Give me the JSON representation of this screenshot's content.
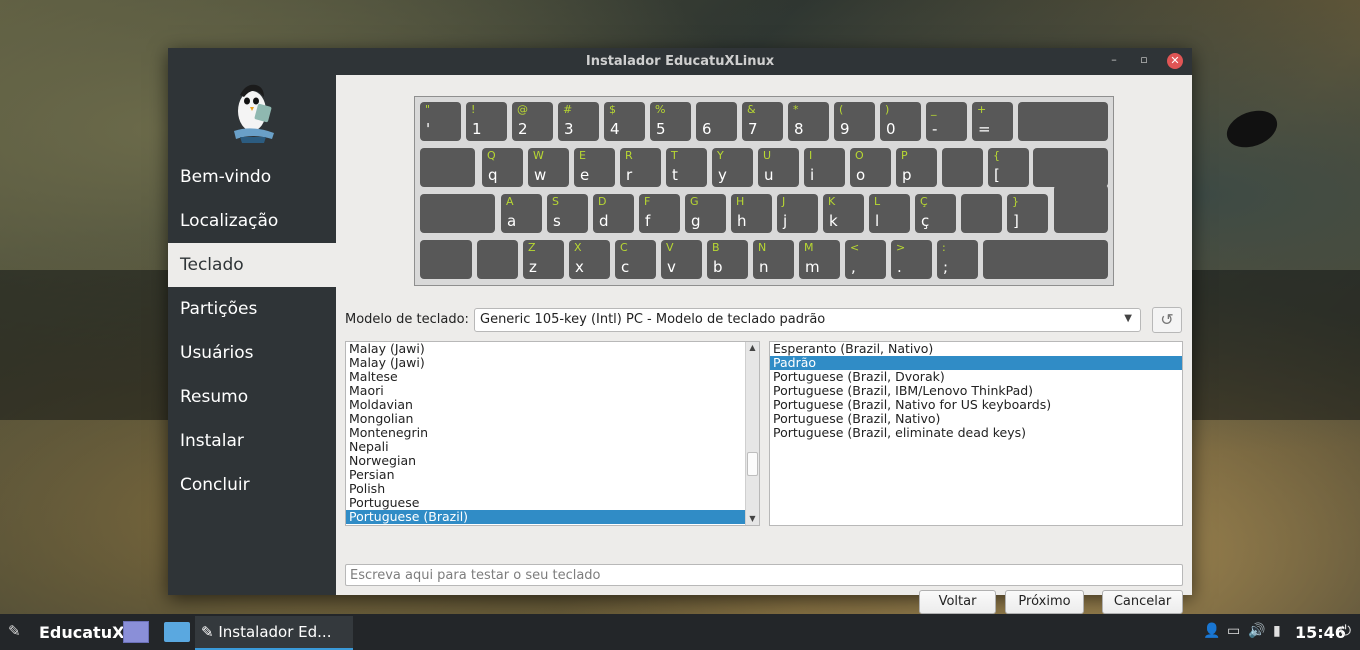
{
  "window": {
    "title": "Instalador EducatuXLinux"
  },
  "sidebar": {
    "items": [
      {
        "label": "Bem-vindo"
      },
      {
        "label": "Localização"
      },
      {
        "label": "Teclado",
        "active": true
      },
      {
        "label": "Partições"
      },
      {
        "label": "Usuários"
      },
      {
        "label": "Resumo"
      },
      {
        "label": "Instalar"
      },
      {
        "label": "Concluir"
      }
    ]
  },
  "keyboard": {
    "row1": [
      {
        "shift": "\"",
        "base": "'"
      },
      {
        "shift": "!",
        "base": "1"
      },
      {
        "shift": "@",
        "base": "2"
      },
      {
        "shift": "#",
        "base": "3"
      },
      {
        "shift": "$",
        "base": "4"
      },
      {
        "shift": "%",
        "base": "5"
      },
      {
        "shift": "",
        "base": "6"
      },
      {
        "shift": "&",
        "base": "7"
      },
      {
        "shift": "*",
        "base": "8"
      },
      {
        "shift": "(",
        "base": "9"
      },
      {
        "shift": ")",
        "base": "0"
      },
      {
        "shift": "_",
        "base": "-"
      },
      {
        "shift": "+",
        "base": "="
      }
    ],
    "row2": [
      {
        "shift": "Q",
        "base": "q"
      },
      {
        "shift": "W",
        "base": "w"
      },
      {
        "shift": "E",
        "base": "e"
      },
      {
        "shift": "R",
        "base": "r"
      },
      {
        "shift": "T",
        "base": "t"
      },
      {
        "shift": "Y",
        "base": "y"
      },
      {
        "shift": "U",
        "base": "u"
      },
      {
        "shift": "I",
        "base": "i"
      },
      {
        "shift": "O",
        "base": "o"
      },
      {
        "shift": "P",
        "base": "p"
      },
      {
        "shift": "",
        "base": ""
      },
      {
        "shift": "{",
        "base": "["
      }
    ],
    "row3": [
      {
        "shift": "A",
        "base": "a"
      },
      {
        "shift": "S",
        "base": "s"
      },
      {
        "shift": "D",
        "base": "d"
      },
      {
        "shift": "F",
        "base": "f"
      },
      {
        "shift": "G",
        "base": "g"
      },
      {
        "shift": "H",
        "base": "h"
      },
      {
        "shift": "J",
        "base": "j"
      },
      {
        "shift": "K",
        "base": "k"
      },
      {
        "shift": "L",
        "base": "l"
      },
      {
        "shift": "Ç",
        "base": "ç"
      },
      {
        "shift": "",
        "base": ""
      },
      {
        "shift": "}",
        "base": "]"
      }
    ],
    "row4": [
      {
        "shift": "Z",
        "base": "z"
      },
      {
        "shift": "X",
        "base": "x"
      },
      {
        "shift": "C",
        "base": "c"
      },
      {
        "shift": "V",
        "base": "v"
      },
      {
        "shift": "B",
        "base": "b"
      },
      {
        "shift": "N",
        "base": "n"
      },
      {
        "shift": "M",
        "base": "m"
      },
      {
        "shift": "<",
        "base": ","
      },
      {
        "shift": ">",
        "base": "."
      },
      {
        "shift": ":",
        "base": ";"
      }
    ]
  },
  "model": {
    "label": "Modelo de teclado:",
    "value": "Generic 105-key (Intl) PC  -  Modelo de teclado padrão"
  },
  "layouts": [
    "Malay (Jawi)",
    "Malay (Jawi)",
    "Maltese",
    "Maori",
    "Moldavian",
    "Mongolian",
    "Montenegrin",
    "Nepali",
    "Norwegian",
    "Persian",
    "Polish",
    "Portuguese",
    "Portuguese (Brazil)"
  ],
  "layout_selected": 12,
  "variants": [
    "Esperanto (Brazil, Nativo)",
    "Padrão",
    "Portuguese (Brazil, Dvorak)",
    "Portuguese (Brazil, IBM/Lenovo ThinkPad)",
    "Portuguese (Brazil, Nativo for US keyboards)",
    "Portuguese (Brazil, Nativo)",
    "Portuguese (Brazil, eliminate dead keys)"
  ],
  "variant_selected": 1,
  "test_input": {
    "placeholder": "Escreva aqui para testar o seu teclado",
    "value": ""
  },
  "buttons": {
    "back": "Voltar",
    "next": "Próximo",
    "cancel": "Cancelar"
  },
  "taskbar": {
    "start_label": "EducatuX",
    "task_label": "Instalador Ed...",
    "clock": "15:46"
  },
  "colors": {
    "sidebar_bg": "#2f3437",
    "selection": "#308cc6",
    "key_bg": "#585858",
    "shift_label": "#b8d832"
  }
}
